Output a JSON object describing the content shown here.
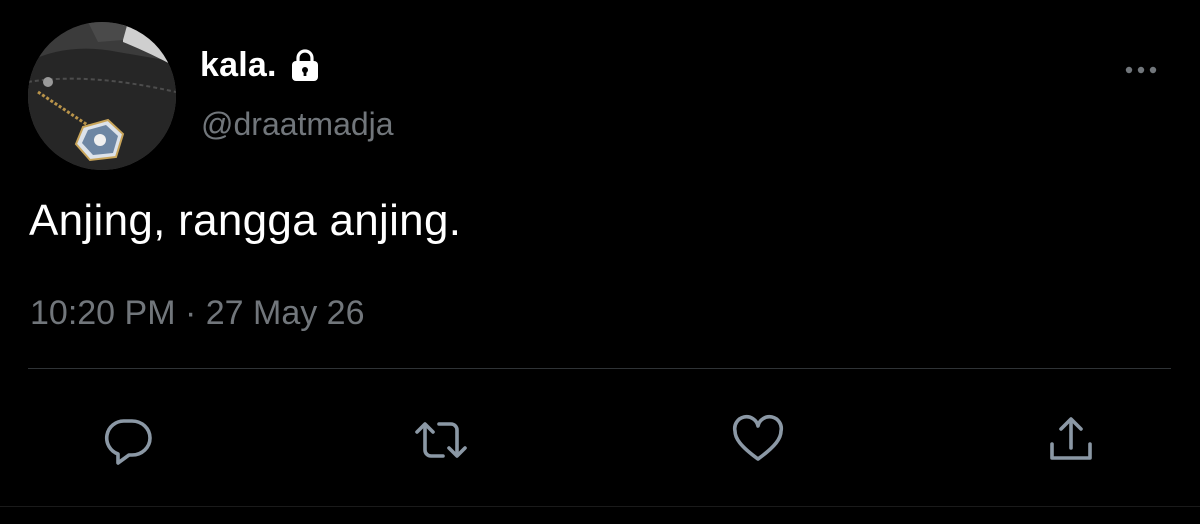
{
  "author": {
    "display_name": "kala.",
    "handle": "@draatmadja",
    "protected": true,
    "avatar_icon": "avatar-photo"
  },
  "tweet": {
    "text": "Anjing, rangga anjing.",
    "timestamp": "10:20 PM · 27 May 26"
  },
  "actions": [
    {
      "name": "reply",
      "icon": "reply-icon"
    },
    {
      "name": "retweet",
      "icon": "retweet-icon"
    },
    {
      "name": "like",
      "icon": "heart-icon"
    },
    {
      "name": "share",
      "icon": "share-icon"
    }
  ],
  "colors": {
    "background": "#000000",
    "primary_text": "#ffffff",
    "secondary_text": "#71767b",
    "divider": "#2f3336",
    "icon": "#8b98a5"
  }
}
